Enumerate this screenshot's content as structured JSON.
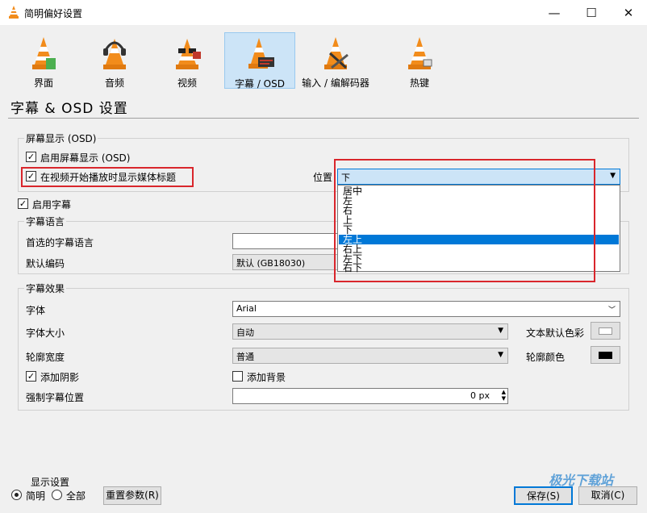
{
  "window": {
    "title": "简明偏好设置",
    "minimize_glyph": "—",
    "maximize_glyph": "☐",
    "close_glyph": "✕"
  },
  "toolbar": [
    {
      "label": "界面",
      "icon": "cone-interface-icon"
    },
    {
      "label": "音频",
      "icon": "cone-headphones-icon"
    },
    {
      "label": "视频",
      "icon": "cone-glasses-icon"
    },
    {
      "label": "字幕 / OSD",
      "icon": "cone-subtitles-icon"
    },
    {
      "label": "输入 / 编解码器",
      "icon": "cone-cables-icon"
    },
    {
      "label": "热键",
      "icon": "cone-hotkeys-icon"
    }
  ],
  "page": {
    "heading": "字幕 & OSD 设置"
  },
  "osd_group": {
    "legend": "屏幕显示 (OSD)",
    "enable_osd": {
      "label": "启用屏幕显示 (OSD)",
      "checked": true
    },
    "show_title": {
      "label": "在视频开始播放时显示媒体标题",
      "checked": true
    },
    "position_label": "位置",
    "position_value": "下",
    "position_options": [
      "居中",
      "左",
      "右",
      "上",
      "下",
      "左上",
      "右上",
      "左下",
      "右下"
    ],
    "position_highlighted": "左上"
  },
  "subtitles": {
    "enable": {
      "label": "启用字幕",
      "checked": true
    },
    "language_group": {
      "legend": "字幕语言",
      "preferred_label": "首选的字幕语言",
      "preferred_value": "",
      "encoding_label": "默认编码",
      "encoding_value": "默认 (GB18030)"
    },
    "effects_group": {
      "legend": "字幕效果",
      "font_label": "字体",
      "font_value": "Arial",
      "size_label": "字体大小",
      "size_value": "自动",
      "text_color_label": "文本默认色彩",
      "text_color": "#ffffff",
      "outline_label": "轮廓宽度",
      "outline_value": "普通",
      "outline_color_label": "轮廓颜色",
      "outline_color": "#000000",
      "shadow": {
        "label": "添加阴影",
        "checked": true
      },
      "background": {
        "label": "添加背景",
        "checked": false
      },
      "force_pos_label": "强制字幕位置",
      "force_pos_value": "0 px"
    }
  },
  "footer": {
    "display_legend": "显示设置",
    "simple_label": "简明",
    "all_label": "全部",
    "selected_mode": "简明",
    "reset_label": "重置参数(R)",
    "save_label": "保存(S)",
    "cancel_label": "取消(C)",
    "watermark": "极光下载站"
  },
  "colors": {
    "highlight_red": "#d9262c",
    "selection_blue": "#0078d7",
    "active_tab_bg": "#cce4f7",
    "cone_orange": "#f28c1b"
  }
}
